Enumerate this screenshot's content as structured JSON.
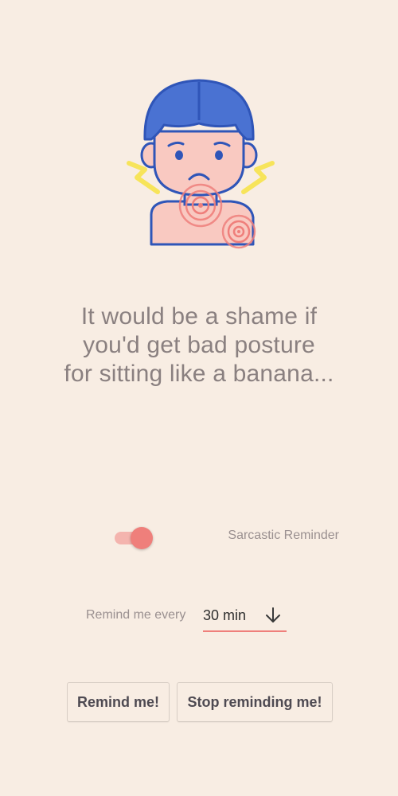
{
  "illustration": {
    "icon": "neck-pain-person-icon",
    "colors": {
      "hair": "#4a72d2",
      "skin": "#f9c9c1",
      "outline": "#2f55b8",
      "pain": "#ef7f7b",
      "lightning": "#f7e45a"
    }
  },
  "message": {
    "lines": [
      "It would be a shame if",
      "you'd get bad posture",
      "for sitting like a banana..."
    ]
  },
  "toggle": {
    "label": "Sarcastic Reminder",
    "checked": true,
    "accent": "#ef7f7b"
  },
  "interval": {
    "label": "Remind me every",
    "value": "30 min",
    "icon": "arrow-down-icon"
  },
  "buttons": {
    "remind": "Remind me!",
    "stop": "Stop reminding me!"
  },
  "colors": {
    "background": "#f8ede3",
    "accent": "#ef7f7b",
    "text_muted": "#9a9090"
  }
}
